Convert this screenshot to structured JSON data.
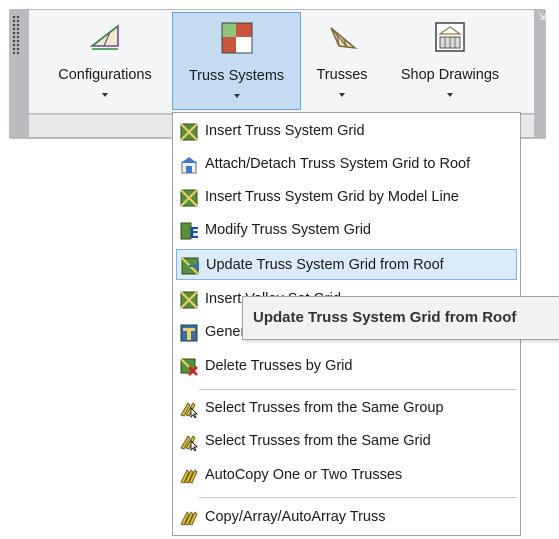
{
  "ribbon": {
    "buttons": [
      {
        "label": "Configurations",
        "icon": "roof-triangle-icon",
        "active": false
      },
      {
        "label": "Truss Systems",
        "icon": "roof-plan-icon",
        "active": true
      },
      {
        "label": "Trusses",
        "icon": "truss-icon",
        "active": false
      },
      {
        "label": "Shop Drawings",
        "icon": "shop-drawing-icon",
        "active": false
      }
    ],
    "launcher_glyph": "⇲"
  },
  "menu": {
    "items": [
      {
        "label": "Insert Truss System Grid",
        "icon": "truss-grid-icon"
      },
      {
        "label": "Attach/Detach Truss System Grid to Roof",
        "icon": "attach-roof-icon"
      },
      {
        "label": "Insert Truss System Grid by Model Line",
        "icon": "grid-model-line-icon"
      },
      {
        "label": "Modify Truss System Grid",
        "icon": "modify-grid-icon"
      },
      {
        "label": "Update Truss System Grid from Roof",
        "icon": "update-grid-icon",
        "highlighted": true
      },
      {
        "label": "Insert Valley Set Grid",
        "icon": "valley-grid-icon"
      },
      {
        "label": "Generate Trusses",
        "icon": "generate-icon"
      },
      {
        "label": "Delete Trusses by Grid",
        "icon": "delete-grid-icon"
      },
      {
        "label": "Select Trusses from the Same Group",
        "icon": "select-group-icon"
      },
      {
        "label": "Select Trusses from the Same Grid",
        "icon": "select-grid-icon"
      },
      {
        "label": "AutoCopy One or Two Trusses",
        "icon": "autocopy-icon"
      },
      {
        "label": "Copy/Array/AutoArray Truss",
        "icon": "copy-array-icon"
      }
    ]
  },
  "tooltip": {
    "text": "Update Truss System Grid from Roof"
  },
  "colors": {
    "active_button_bg": "#c3dcf2",
    "highlight_bg": "#dcebfb",
    "highlight_border": "#7eb4ea",
    "grid_green": "#5a8f3c"
  }
}
